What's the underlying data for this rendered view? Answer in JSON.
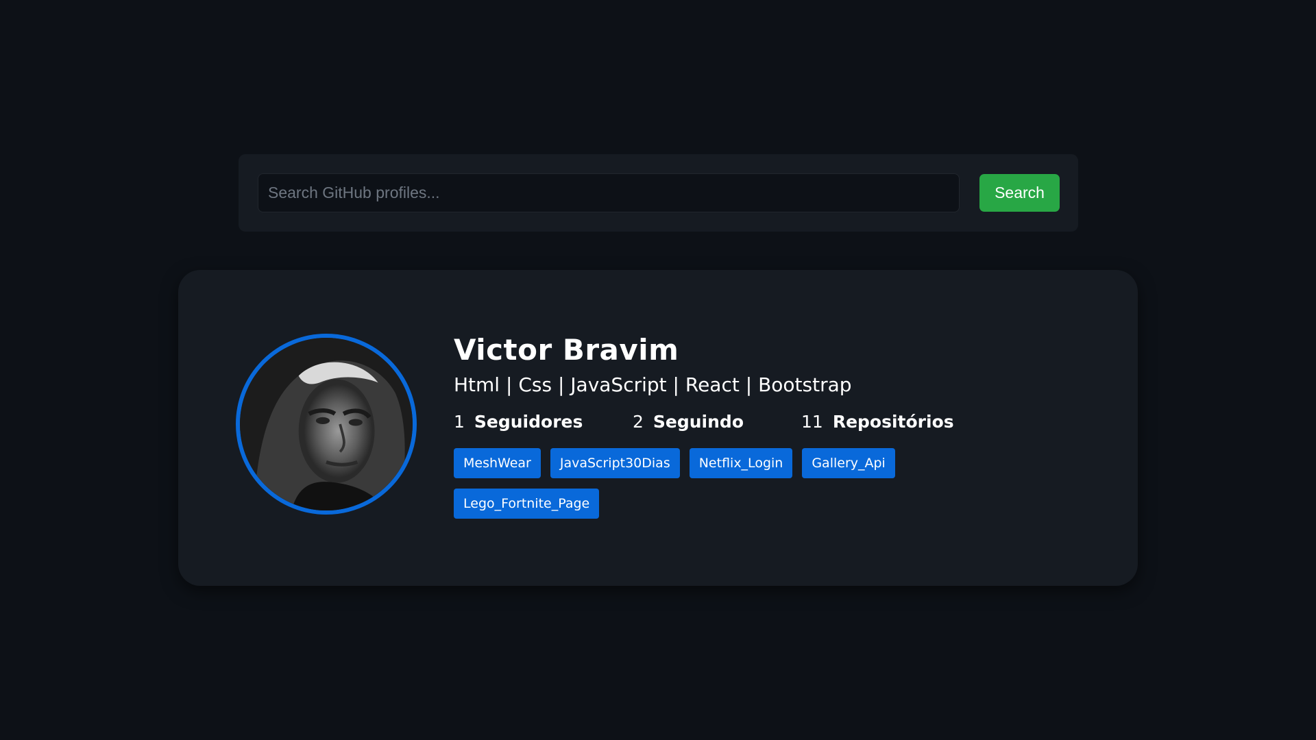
{
  "search": {
    "placeholder": "Search GitHub profiles...",
    "value": "",
    "button_label": "Search"
  },
  "profile": {
    "name": "Victor Bravim",
    "bio": "Html | Css | JavaScript | React | Bootstrap",
    "stats": {
      "followers": {
        "value": "1",
        "label": "Seguidores"
      },
      "following": {
        "value": "2",
        "label": "Seguindo"
      },
      "repositories": {
        "value": "11",
        "label": "Repositórios"
      }
    },
    "repos": [
      "MeshWear",
      "JavaScript30Dias",
      "Netflix_Login",
      "Gallery_Api",
      "Lego_Fortnite_Page"
    ]
  },
  "colors": {
    "background": "#0d1117",
    "panel": "#161b22",
    "accent_blue": "#0969da",
    "button_green": "#28a745"
  }
}
